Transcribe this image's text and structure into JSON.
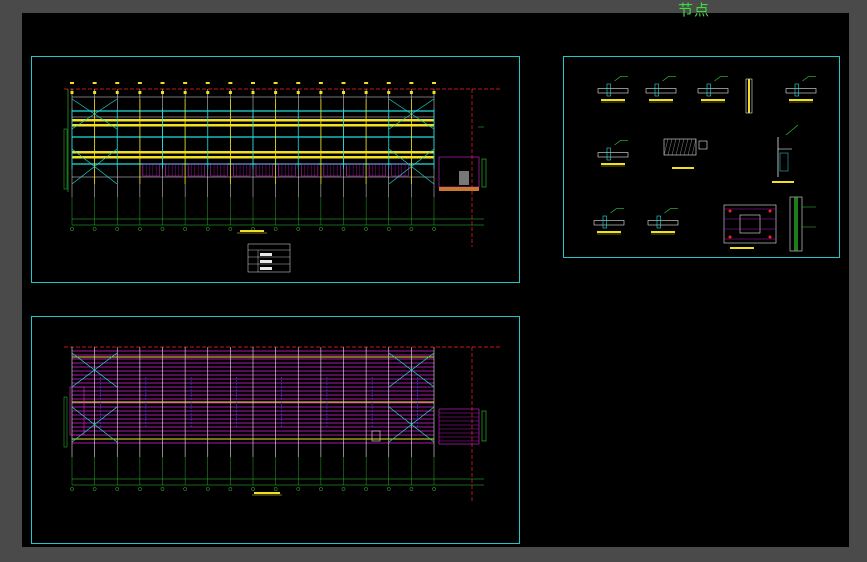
{
  "sheet": {
    "title": "节点"
  },
  "colors": {
    "background": "#4a4a4a",
    "sheet": "#000000",
    "frame": "#1fc8c8",
    "yellow": "#f0e020",
    "cyan": "#20e0e0",
    "magenta": "#e020e0",
    "green": "#30d030",
    "red": "#ff2020",
    "white": "#e8e8e8",
    "blue": "#3050ff"
  }
}
